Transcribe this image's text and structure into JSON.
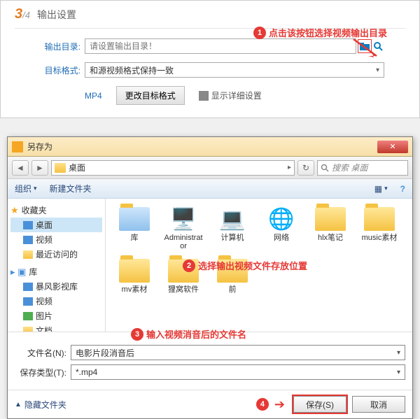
{
  "panel": {
    "step_big": "3",
    "step_small": "/4",
    "title": "输出设置",
    "output_dir_label": "输出目录:",
    "output_dir_placeholder": "请设置输出目录！",
    "target_format_label": "目标格式:",
    "target_format_value": "和源视频格式保持一致",
    "mp4_link": "MP4",
    "change_format_btn": "更改目标格式",
    "show_detail": "显示详细设置"
  },
  "annotations": {
    "a1": "点击该按钮选择视频输出目录",
    "a2": "选择输出视频文件存放位置",
    "a3": "输入视频消音后的文件名"
  },
  "dialog": {
    "title": "另存为",
    "address_text": "桌面",
    "search_placeholder": "搜索 桌面",
    "toolbar_org": "组织",
    "toolbar_new": "新建文件夹"
  },
  "sidebar": {
    "favorites": "收藏夹",
    "desktop": "桌面",
    "video": "视频",
    "recent": "最近访问的",
    "lib": "库",
    "bf": "暴风影视库",
    "vlib": "视频",
    "pic": "图片",
    "doc": "文档"
  },
  "items": {
    "i0": "库",
    "i1": "Administrator",
    "i2": "计算机",
    "i3": "网络",
    "i4": "hlx笔记",
    "i5": "music素材",
    "i6": "mv素材",
    "i7": "狸窝软件",
    "i8": "前"
  },
  "bottom": {
    "name_label": "文件名(N):",
    "name_value": "电影片段消音后",
    "type_label": "保存类型(T):",
    "type_value": "*.mp4",
    "hide_folders": "隐藏文件夹",
    "save_btn": "保存(S)",
    "cancel_btn": "取消"
  }
}
